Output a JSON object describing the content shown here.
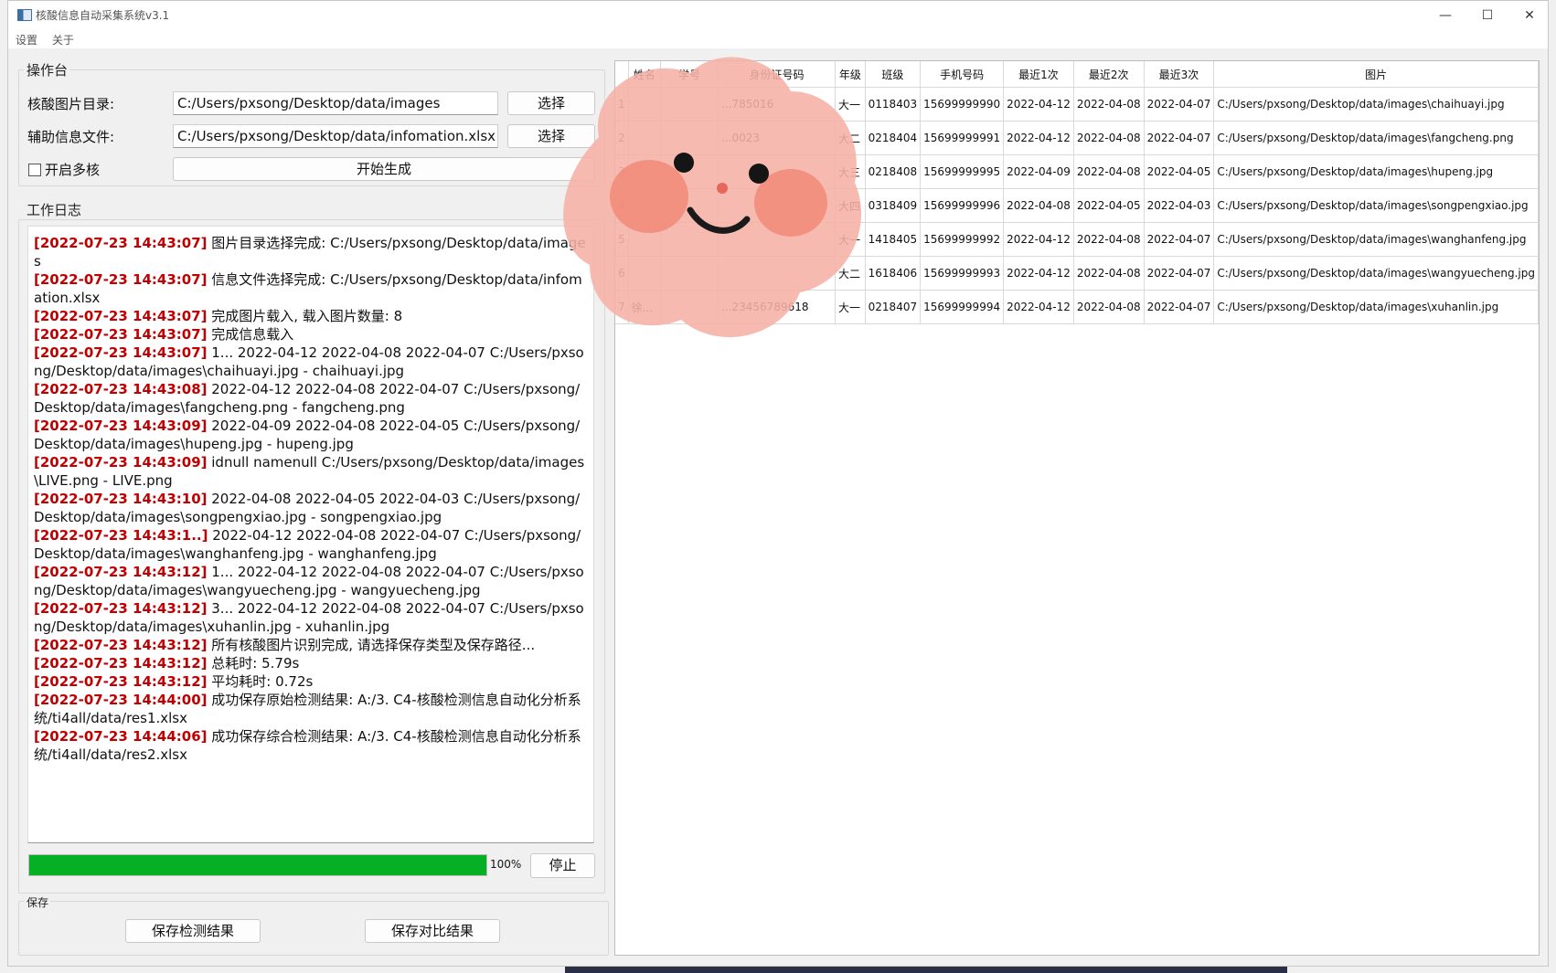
{
  "window": {
    "title": "核酸信息自动采集系统v3.1",
    "minimize_glyph": "—",
    "maximize_glyph": "☐",
    "close_glyph": "✕"
  },
  "menu": [
    "设置",
    "关于"
  ],
  "console": {
    "title": "操作台",
    "image_dir_label": "核酸图片目录:",
    "image_dir_value": "C:/Users/pxsong/Desktop/data/images",
    "info_file_label": "辅助信息文件:",
    "info_file_value": "C:/Users/pxsong/Desktop/data/infomation.xlsx",
    "choose_label": "选择",
    "multicore_label": "开启多核",
    "start_label": "开始生成"
  },
  "log": {
    "title": "工作日志",
    "entries": [
      {
        "ts": "[2022-07-23 14:43:07]",
        "text": " 图片目录选择完成: C:/Users/pxsong/Desktop/data/images"
      },
      {
        "ts": "[2022-07-23 14:43:07]",
        "text": " 信息文件选择完成: C:/Users/pxsong/Desktop/data/infomation.xlsx"
      },
      {
        "ts": "[2022-07-23 14:43:07]",
        "text": " 完成图片载入, 载入图片数量: 8"
      },
      {
        "ts": "[2022-07-23 14:43:07]",
        "text": " 完成信息载入"
      },
      {
        "ts": "[2022-07-23 14:43:07]",
        "text": " 1...  2022-04-12 2022-04-08 2022-04-07 C:/Users/pxsong/Desktop/data/images\\chaihuayi.jpg - chaihuayi.jpg"
      },
      {
        "ts": "[2022-07-23 14:43:08]",
        "text": " 2022-04-12 2022-04-08 2022-04-07 C:/Users/pxsong/Desktop/data/images\\fangcheng.png - fangcheng.png"
      },
      {
        "ts": "[2022-07-23 14:43:09]",
        "text": " 2022-04-09 2022-04-08 2022-04-05 C:/Users/pxsong/Desktop/data/images\\hupeng.jpg - hupeng.jpg"
      },
      {
        "ts": "[2022-07-23 14:43:09]",
        "text": " idnull namenull C:/Users/pxsong/Desktop/data/images\\LIVE.png - LIVE.png"
      },
      {
        "ts": "[2022-07-23 14:43:10]",
        "text": " 2022-04-08 2022-04-05 2022-04-03 C:/Users/pxsong/Desktop/data/images\\songpengxiao.jpg - songpengxiao.jpg"
      },
      {
        "ts": "[2022-07-23 14:43:1..]",
        "text": " 2022-04-12 2022-04-08 2022-04-07 C:/Users/pxsong/Desktop/data/images\\wanghanfeng.jpg - wanghanfeng.jpg"
      },
      {
        "ts": "[2022-07-23 14:43:12]",
        "text": " 1... 2022-04-12 2022-04-08 2022-04-07 C:/Users/pxsong/Desktop/data/images\\wangyuecheng.jpg - wangyuecheng.jpg"
      },
      {
        "ts": "[2022-07-23 14:43:12]",
        "text": " 3... 2022-04-12 2022-04-08 2022-04-07 C:/Users/pxsong/Desktop/data/images\\xuhanlin.jpg - xuhanlin.jpg"
      },
      {
        "ts": "[2022-07-23 14:43:12]",
        "text": " 所有核酸图片识别完成, 请选择保存类型及保存路径..."
      },
      {
        "ts": "[2022-07-23 14:43:12]",
        "text": " 总耗时: 5.79s"
      },
      {
        "ts": "[2022-07-23 14:43:12]",
        "text": " 平均耗时: 0.72s"
      },
      {
        "ts": "[2022-07-23 14:44:00]",
        "text": " 成功保存原始检测结果: A:/3. C4-核酸检测信息自动化分析系统/ti4all/data/res1.xlsx"
      },
      {
        "ts": "[2022-07-23 14:44:06]",
        "text": " 成功保存综合检测结果: A:/3. C4-核酸检测信息自动化分析系统/ti4all/data/res2.xlsx"
      }
    ]
  },
  "progress": {
    "value": 1.0,
    "text": "100%"
  },
  "stop_label": "停止",
  "save": {
    "title": "保存",
    "save_detect_label": "保存检测结果",
    "save_compare_label": "保存对比结果"
  },
  "table": {
    "columns": [
      "姓名",
      "学号",
      "身份证号码",
      "年级",
      "班级",
      "手机号码",
      "最近1次",
      "最近2次",
      "最近3次",
      "图片"
    ],
    "rows": [
      [
        "1",
        "",
        "",
        "...785016",
        "大一",
        "0118403",
        "15699999990",
        "2022-04-12",
        "2022-04-08",
        "2022-04-07",
        "C:/Users/pxsong/Desktop/data/images\\chaihuayi.jpg"
      ],
      [
        "2",
        "",
        "",
        "...0023",
        "大二",
        "0218404",
        "15699999991",
        "2022-04-12",
        "2022-04-08",
        "2022-04-07",
        "C:/Users/pxsong/Desktop/data/images\\fangcheng.png"
      ],
      [
        "3",
        "",
        "",
        "",
        "大三",
        "0218408",
        "15699999995",
        "2022-04-09",
        "2022-04-08",
        "2022-04-05",
        "C:/Users/pxsong/Desktop/data/images\\hupeng.jpg"
      ],
      [
        "4",
        "",
        "",
        "",
        "大四",
        "0318409",
        "15699999996",
        "2022-04-08",
        "2022-04-05",
        "2022-04-03",
        "C:/Users/pxsong/Desktop/data/images\\songpengxiao.jpg"
      ],
      [
        "5",
        "",
        "",
        "",
        "大一",
        "1418405",
        "15699999992",
        "2022-04-12",
        "2022-04-08",
        "2022-04-07",
        "C:/Users/pxsong/Desktop/data/images\\wanghanfeng.jpg"
      ],
      [
        "6",
        "",
        "",
        "",
        "大二",
        "1618406",
        "15699999993",
        "2022-04-12",
        "2022-04-08",
        "2022-04-07",
        "C:/Users/pxsong/Desktop/data/images\\wangyuecheng.jpg"
      ],
      [
        "7",
        "徐...",
        "",
        "...23456789618",
        "大一",
        "0218407",
        "15699999994",
        "2022-04-12",
        "2022-04-08",
        "2022-04-07",
        "C:/Users/pxsong/Desktop/data/images\\xuhanlin.jpg"
      ]
    ]
  },
  "colors": {
    "progress": "#06b025",
    "timestamp": "#c00000",
    "sticker": "#f6b1a6"
  }
}
